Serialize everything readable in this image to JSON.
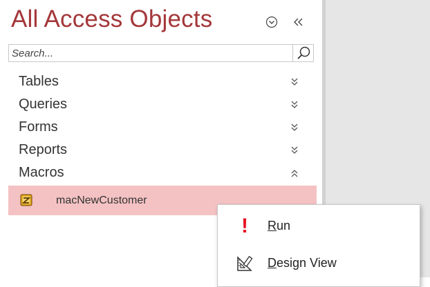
{
  "nav_pane": {
    "title": "All Access Objects",
    "menu_button": "chevron-circle-down-icon",
    "collapse_button": "double-chevron-left-icon",
    "search": {
      "placeholder": "Search...",
      "value": ""
    },
    "groups": [
      {
        "label": "Tables",
        "state": "collapsed",
        "chevron": "double-chevron-down-icon"
      },
      {
        "label": "Queries",
        "state": "collapsed",
        "chevron": "double-chevron-down-icon"
      },
      {
        "label": "Forms",
        "state": "collapsed",
        "chevron": "double-chevron-down-icon"
      },
      {
        "label": "Reports",
        "state": "collapsed",
        "chevron": "double-chevron-down-icon"
      },
      {
        "label": "Macros",
        "state": "expanded",
        "chevron": "double-chevron-up-icon"
      }
    ],
    "selected_object": {
      "label": "macNewCustomer",
      "icon": "macro-icon"
    }
  },
  "context_menu": {
    "items": [
      {
        "label_first": "R",
        "label_rest": "un",
        "icon": "run-icon"
      },
      {
        "label_first": "D",
        "label_rest": "esign View",
        "icon": "design-view-icon"
      }
    ]
  },
  "colors": {
    "title": "#a4373a",
    "selection": "#f4c2c3",
    "run_icon": "#e81123",
    "workspace": "#e6e6e6",
    "divider": "#d2d2d2"
  }
}
